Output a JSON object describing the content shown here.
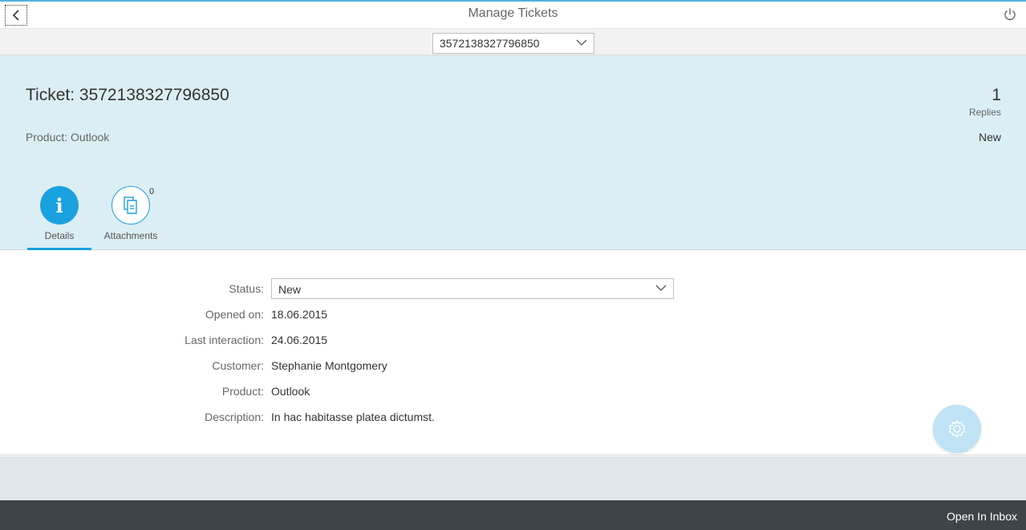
{
  "header": {
    "title": "Manage Tickets",
    "back_icon": "chevron-left-icon",
    "power_icon": "power-icon"
  },
  "selector": {
    "value": "3572138327796850"
  },
  "ticket": {
    "title": "Ticket: 3572138327796850",
    "product": "Product: Outlook",
    "replies_count": "1",
    "replies_label": "Replies",
    "status": "New"
  },
  "tabs": [
    {
      "label": "Details",
      "icon": "info-icon",
      "selected": true
    },
    {
      "label": "Attachments",
      "icon": "documents-icon",
      "count": "0"
    }
  ],
  "form": {
    "status_label": "Status:",
    "status_value": "New",
    "opened_label": "Opened on:",
    "opened_value": "18.06.2015",
    "last_label": "Last interaction:",
    "last_value": "24.06.2015",
    "customer_label": "Customer:",
    "customer_value": "Stephanie Montgomery",
    "product_label": "Product:",
    "product_value": "Outlook",
    "description_label": "Description:",
    "description_value": "In hac habitasse platea dictumst."
  },
  "fab_icon": "settings-icon",
  "footer": {
    "open_inbox": "Open In Inbox"
  },
  "colors": {
    "accent": "#1aa1e0",
    "header_bg": "#dbeef3",
    "footer_bg": "#3f4449"
  }
}
